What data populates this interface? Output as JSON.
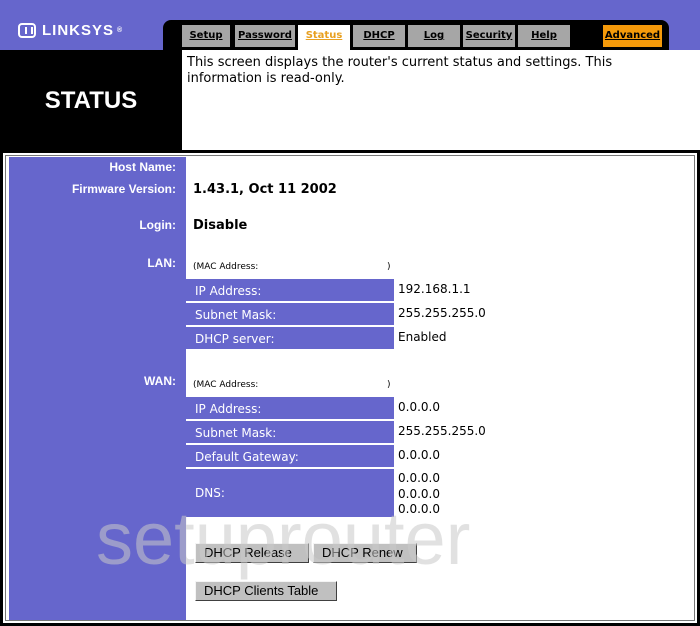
{
  "brand": {
    "name": "LINKSYS",
    "registered": "®"
  },
  "tabs": [
    {
      "label": "Setup",
      "active": false
    },
    {
      "label": "Password",
      "active": false
    },
    {
      "label": "Status",
      "active": true
    },
    {
      "label": "DHCP",
      "active": false
    },
    {
      "label": "Log",
      "active": false
    },
    {
      "label": "Security",
      "active": false
    },
    {
      "label": "Help",
      "active": false
    },
    {
      "label": "Advanced",
      "active": false
    }
  ],
  "page": {
    "title": "STATUS",
    "description": "This screen displays the router's current status and settings. This information is read-only."
  },
  "status": {
    "host_name": {
      "label": "Host Name:",
      "value": ""
    },
    "firmware": {
      "label": "Firmware Version:",
      "value": "1.43.1, Oct 11 2002"
    },
    "login": {
      "label": "Login:",
      "value": "Disable"
    },
    "lan": {
      "label": "LAN:",
      "mac_open": "(MAC Address:",
      "mac_close": ")",
      "rows": [
        {
          "label": "IP Address:",
          "value": "192.168.1.1"
        },
        {
          "label": "Subnet Mask:",
          "value": "255.255.255.0"
        },
        {
          "label": "DHCP server:",
          "value": "Enabled"
        }
      ]
    },
    "wan": {
      "label": "WAN:",
      "mac_open": "(MAC Address:",
      "mac_close": ")",
      "rows": [
        {
          "label": "IP Address:",
          "value": "0.0.0.0"
        },
        {
          "label": "Subnet Mask:",
          "value": "255.255.255.0"
        },
        {
          "label": "Default Gateway:",
          "value": "0.0.0.0"
        }
      ],
      "dns": {
        "label": "DNS:",
        "values": [
          "0.0.0.0",
          "0.0.0.0",
          "0.0.0.0"
        ]
      }
    }
  },
  "buttons": {
    "dhcp_release": "DHCP Release",
    "dhcp_renew": "DHCP Renew",
    "dhcp_clients_table": "DHCP Clients Table"
  },
  "watermark": "setuprouter",
  "colors": {
    "brand_purple": "#6666cc",
    "active_tab_text": "#e8a020",
    "advanced_tab": "#f59a0a",
    "tab_gray": "#a6a6a6"
  }
}
